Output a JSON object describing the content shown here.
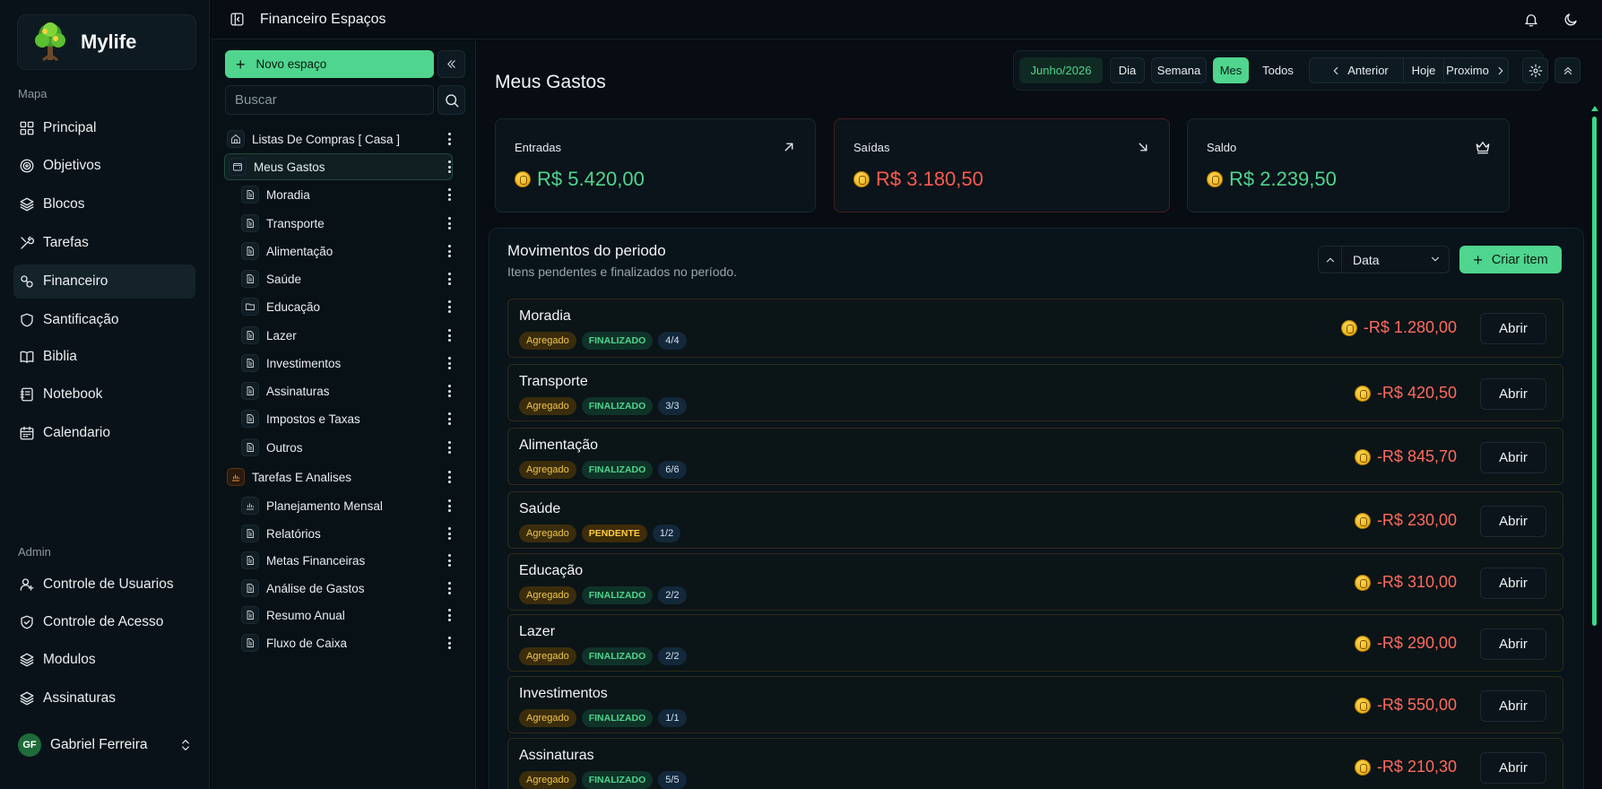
{
  "brand": {
    "name": "Mylife"
  },
  "sidebar": {
    "section_main": "Mapa",
    "items": [
      {
        "label": "Principal",
        "icon": "grid-icon"
      },
      {
        "label": "Objetivos",
        "icon": "target-icon"
      },
      {
        "label": "Blocos",
        "icon": "layers-icon"
      },
      {
        "label": "Tarefas",
        "icon": "tools-icon"
      },
      {
        "label": "Financeiro",
        "icon": "finance-icon",
        "active": true
      },
      {
        "label": "Santificação",
        "icon": "shield-icon"
      },
      {
        "label": "Biblia",
        "icon": "book-icon"
      },
      {
        "label": "Notebook",
        "icon": "notebook-icon"
      },
      {
        "label": "Calendario",
        "icon": "calendar-icon"
      }
    ],
    "section_admin": "Admin",
    "admin_items": [
      {
        "label": "Controle de Usuarios",
        "icon": "users-icon"
      },
      {
        "label": "Controle de Acesso",
        "icon": "shield-check-icon"
      },
      {
        "label": "Modulos",
        "icon": "layers-icon"
      },
      {
        "label": "Assinaturas",
        "icon": "layers-icon"
      }
    ],
    "user": {
      "initials": "GF",
      "name": "Gabriel Ferreira"
    }
  },
  "topbar": {
    "title": "Financeiro Espaços"
  },
  "panel": {
    "new_space_label": "Novo espaço",
    "search_placeholder": "Buscar",
    "tree": [
      {
        "label": "Listas De Compras [ Casa ]",
        "icon": "home-icon",
        "level": 0
      },
      {
        "label": "Meus Gastos",
        "icon": "wallet-icon",
        "level": 0,
        "selected": true
      },
      {
        "label": "Moradia",
        "icon": "doc-icon",
        "level": 1
      },
      {
        "label": "Transporte",
        "icon": "doc-icon",
        "level": 1
      },
      {
        "label": "Alimentação",
        "icon": "doc-icon",
        "level": 1
      },
      {
        "label": "Saúde",
        "icon": "doc-icon",
        "level": 1
      },
      {
        "label": "Educação",
        "icon": "folder-icon",
        "level": 1
      },
      {
        "label": "Lazer",
        "icon": "doc-icon",
        "level": 1
      },
      {
        "label": "Investimentos",
        "icon": "doc-icon",
        "level": 1
      },
      {
        "label": "Assinaturas",
        "icon": "doc-icon",
        "level": 1
      },
      {
        "label": "Impostos e Taxas",
        "icon": "doc-icon",
        "level": 1
      },
      {
        "label": "Outros",
        "icon": "doc-icon",
        "level": 1
      },
      {
        "label": "Tarefas E Analises",
        "icon": "chart-icon",
        "level": 0,
        "accent": "#ff9f43"
      },
      {
        "label": "Planejamento Mensal",
        "icon": "chart-icon",
        "level": 1
      },
      {
        "label": "Relatórios",
        "icon": "doc-icon",
        "level": 1
      },
      {
        "label": "Metas Financeiras",
        "icon": "doc-icon",
        "level": 1
      },
      {
        "label": "Análise de Gastos",
        "icon": "doc-icon",
        "level": 1
      },
      {
        "label": "Resumo Anual",
        "icon": "doc-icon",
        "level": 1
      },
      {
        "label": "Fluxo de Caixa",
        "icon": "doc-icon",
        "level": 1
      }
    ]
  },
  "main": {
    "title": "Meus Gastos",
    "period": "Junho/2026",
    "view_options": [
      "Dia",
      "Semana",
      "Mes",
      "Todos"
    ],
    "active_view": "Mes",
    "nav": {
      "prev": "Anterior",
      "today": "Hoje",
      "next": "Proximo"
    },
    "cards": [
      {
        "label": "Entradas",
        "value": "R$ 5.420,00",
        "color": "#4fd58e",
        "icon": "arrow-up-right-icon"
      },
      {
        "label": "Saídas",
        "value": "R$ 3.180,50",
        "color": "#ff5a4e",
        "icon": "arrow-down-right-icon"
      },
      {
        "label": "Saldo",
        "value": "R$ 2.239,50",
        "color": "#4fd58e",
        "icon": "crown-icon"
      }
    ],
    "moves": {
      "title": "Movimentos do periodo",
      "subtitle": "Itens pendentes e finalizados no período.",
      "sort_label": "Data",
      "create_label": "Criar item",
      "open_label": "Abrir",
      "rows": [
        {
          "name": "Moradia",
          "type": "Agregado",
          "status": "FINALIZADO",
          "count": "4/4",
          "amount": "-R$ 1.280,00"
        },
        {
          "name": "Transporte",
          "type": "Agregado",
          "status": "FINALIZADO",
          "count": "3/3",
          "amount": "-R$ 420,50"
        },
        {
          "name": "Alimentação",
          "type": "Agregado",
          "status": "FINALIZADO",
          "count": "6/6",
          "amount": "-R$ 845,70"
        },
        {
          "name": "Saúde",
          "type": "Agregado",
          "status": "PENDENTE",
          "count": "1/2",
          "amount": "-R$ 230,00"
        },
        {
          "name": "Educação",
          "type": "Agregado",
          "status": "FINALIZADO",
          "count": "2/2",
          "amount": "-R$ 310,00"
        },
        {
          "name": "Lazer",
          "type": "Agregado",
          "status": "FINALIZADO",
          "count": "2/2",
          "amount": "-R$ 290,00"
        },
        {
          "name": "Investimentos",
          "type": "Agregado",
          "status": "FINALIZADO",
          "count": "1/1",
          "amount": "-R$ 550,00"
        },
        {
          "name": "Assinaturas",
          "type": "Agregado",
          "status": "FINALIZADO",
          "count": "5/5",
          "amount": "-R$ 210,30"
        }
      ]
    }
  }
}
